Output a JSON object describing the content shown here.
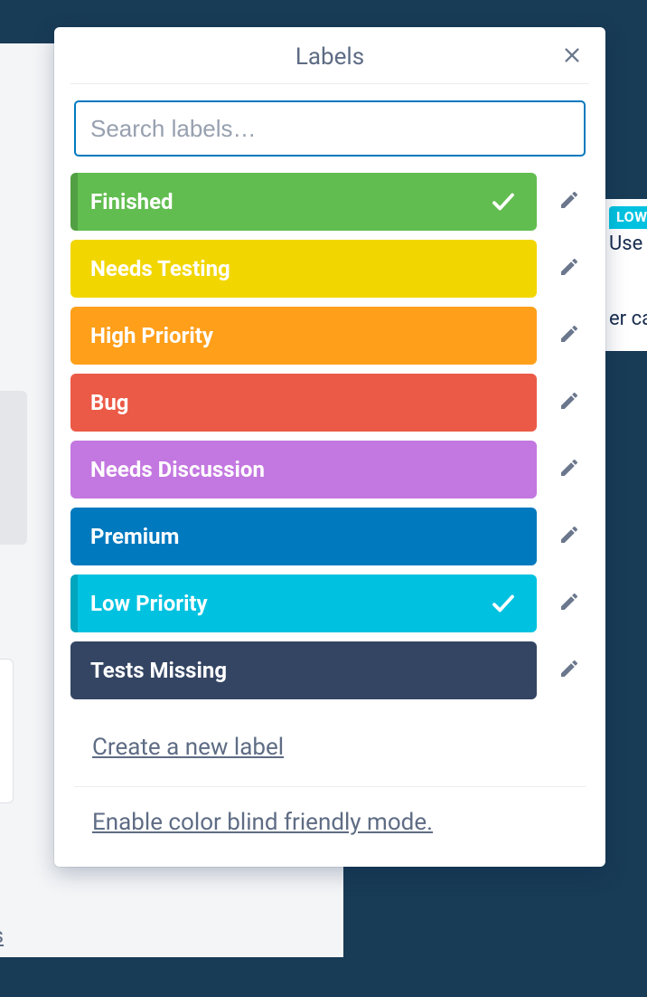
{
  "popover": {
    "title": "Labels",
    "search_placeholder": "Search labels…",
    "create_label": "Create a new label",
    "colorblind_label": "Enable color blind friendly mode."
  },
  "labels": [
    {
      "name": "Finished",
      "color": "#61bd4f",
      "selected": true
    },
    {
      "name": "Needs Testing",
      "color": "#f2d600",
      "selected": false
    },
    {
      "name": "High Priority",
      "color": "#ff9f1a",
      "selected": false
    },
    {
      "name": "Bug",
      "color": "#eb5a46",
      "selected": false
    },
    {
      "name": "Needs Discussion",
      "color": "#c377e0",
      "selected": false
    },
    {
      "name": "Premium",
      "color": "#0079bf",
      "selected": false
    },
    {
      "name": "Low Priority",
      "color": "#00c2e0",
      "selected": true
    },
    {
      "name": "Tests Missing",
      "color": "#344563",
      "selected": false
    }
  ],
  "background": {
    "partial_link": "ils",
    "right_badge": "LOW",
    "right_text1": "Use",
    "right_text2": "er ca"
  }
}
